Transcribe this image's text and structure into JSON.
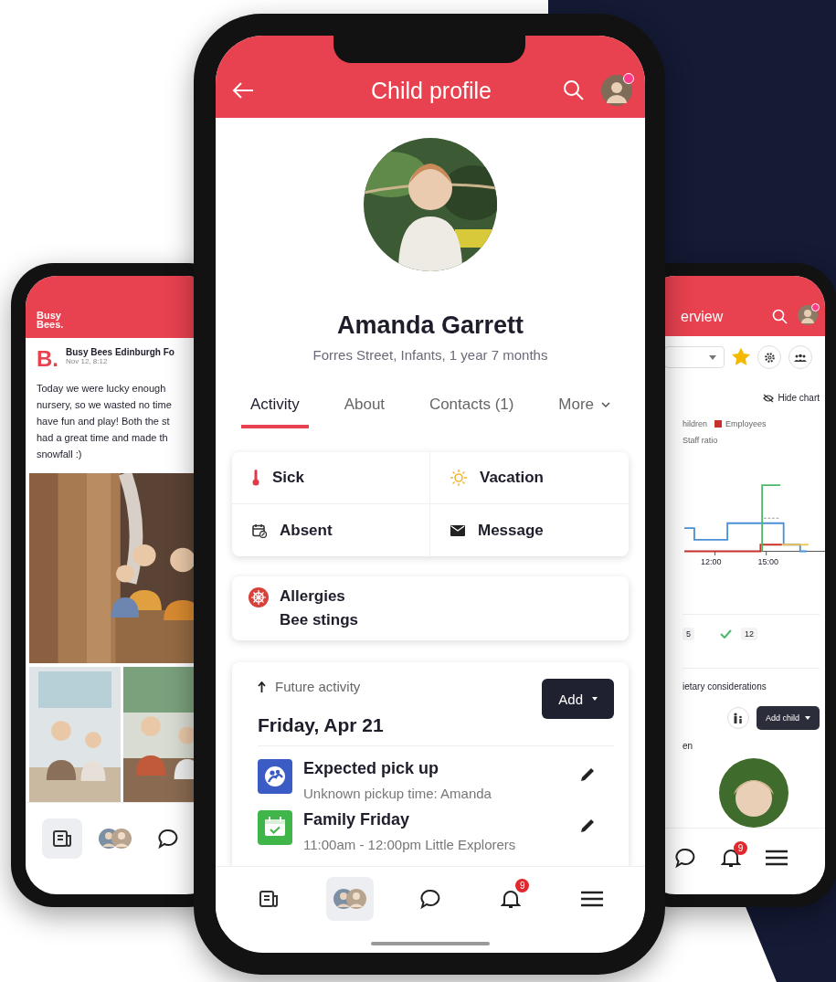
{
  "left_phone": {
    "header": {
      "logo_lines": [
        "Busy",
        "Bees."
      ]
    },
    "post": {
      "logo": "B.",
      "author": "Busy Bees Edinburgh Fo",
      "date": "Nov 12, 8:12",
      "text_lines": [
        "Today we were lucky enough",
        "nursery, so we wasted no time",
        "have fun and play! Both the st",
        "had a great time and made th",
        "snowfall :)"
      ]
    },
    "nav": [
      {
        "kind": "news",
        "selected": true
      },
      {
        "kind": "avatars",
        "selected": false
      },
      {
        "kind": "chat",
        "selected": false
      }
    ]
  },
  "center_phone": {
    "header": {
      "title": "Child profile"
    },
    "child": {
      "name": "Amanda Garrett",
      "details": "Forres Street, Infants, 1 year 7 months"
    },
    "tabs": [
      {
        "label": "Activity",
        "selected": true,
        "dropdown": false
      },
      {
        "label": "About",
        "selected": false,
        "dropdown": false
      },
      {
        "label": "Contacts (1)",
        "selected": false,
        "dropdown": false
      },
      {
        "label": "More",
        "selected": false,
        "dropdown": true
      }
    ],
    "actions": [
      {
        "kind": "sick",
        "label": "Sick"
      },
      {
        "kind": "vacation",
        "label": "Vacation"
      },
      {
        "kind": "absent",
        "label": "Absent"
      },
      {
        "kind": "message",
        "label": "Message"
      }
    ],
    "allergies": {
      "title": "Allergies",
      "detail": "Bee stings"
    },
    "future": {
      "heading": "Future activity",
      "add_button": "Add",
      "date": "Friday, Apr 21",
      "items": [
        {
          "kind": "pickup",
          "title": "Expected pick up",
          "detail": "Unknown pickup time: Amanda",
          "color": "#3b5cc4"
        },
        {
          "kind": "event",
          "title": "Family Friday",
          "detail": "11:00am - 12:00pm Little Explorers",
          "color": "#3fb54a"
        }
      ]
    },
    "nav": [
      {
        "kind": "news",
        "selected": false
      },
      {
        "kind": "avatars",
        "selected": true
      },
      {
        "kind": "chat",
        "selected": false
      },
      {
        "kind": "bell",
        "selected": false,
        "badge": "9"
      },
      {
        "kind": "menu",
        "selected": false
      }
    ]
  },
  "right_phone": {
    "header": {
      "title": "erview"
    },
    "toolbar": {
      "starred": true
    },
    "hide_chart": "Hide chart",
    "legend": [
      {
        "label": "hildren"
      },
      {
        "label": "Employees",
        "color": "#c8302a"
      },
      {
        "label": "Staff ratio"
      }
    ],
    "xticks": [
      "12:00",
      "15:00"
    ],
    "counts": [
      {
        "kind": "plain",
        "value": "5"
      },
      {
        "kind": "check",
        "value": "12"
      }
    ],
    "section_title": "ietary considerations",
    "add_child": "Add child",
    "cut_label": "en",
    "nav": [
      {
        "kind": "chat",
        "selected": false
      },
      {
        "kind": "bell",
        "selected": false,
        "badge": "9"
      },
      {
        "kind": "menu",
        "selected": false
      }
    ]
  }
}
